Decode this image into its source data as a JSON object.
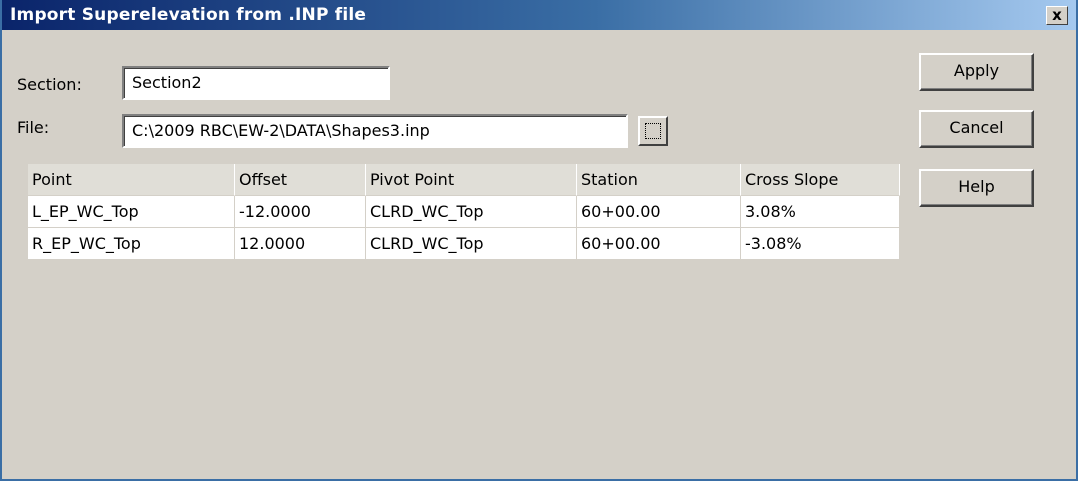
{
  "window": {
    "title": "Import Superelevation from .INP file",
    "close_glyph": "x"
  },
  "form": {
    "section_label": "Section:",
    "section_value": "Section2",
    "file_label": "File:",
    "file_value": "C:\\2009 RBC\\EW-2\\DATA\\Shapes3.inp"
  },
  "buttons": {
    "apply": "Apply",
    "cancel": "Cancel",
    "help": "Help"
  },
  "table": {
    "columns": [
      "Point",
      "Offset",
      "Pivot Point",
      "Station",
      "Cross Slope"
    ],
    "rows": [
      [
        "L_EP_WC_Top",
        "-12.0000",
        "CLRD_WC_Top",
        "60+00.00",
        "3.08%"
      ],
      [
        "R_EP_WC_Top",
        "12.0000",
        "CLRD_WC_Top",
        "60+00.00",
        "-3.08%"
      ]
    ]
  },
  "colors": {
    "titlebar_start": "#0a246a",
    "titlebar_end": "#a6caf0",
    "face": "#d4d0c8"
  }
}
